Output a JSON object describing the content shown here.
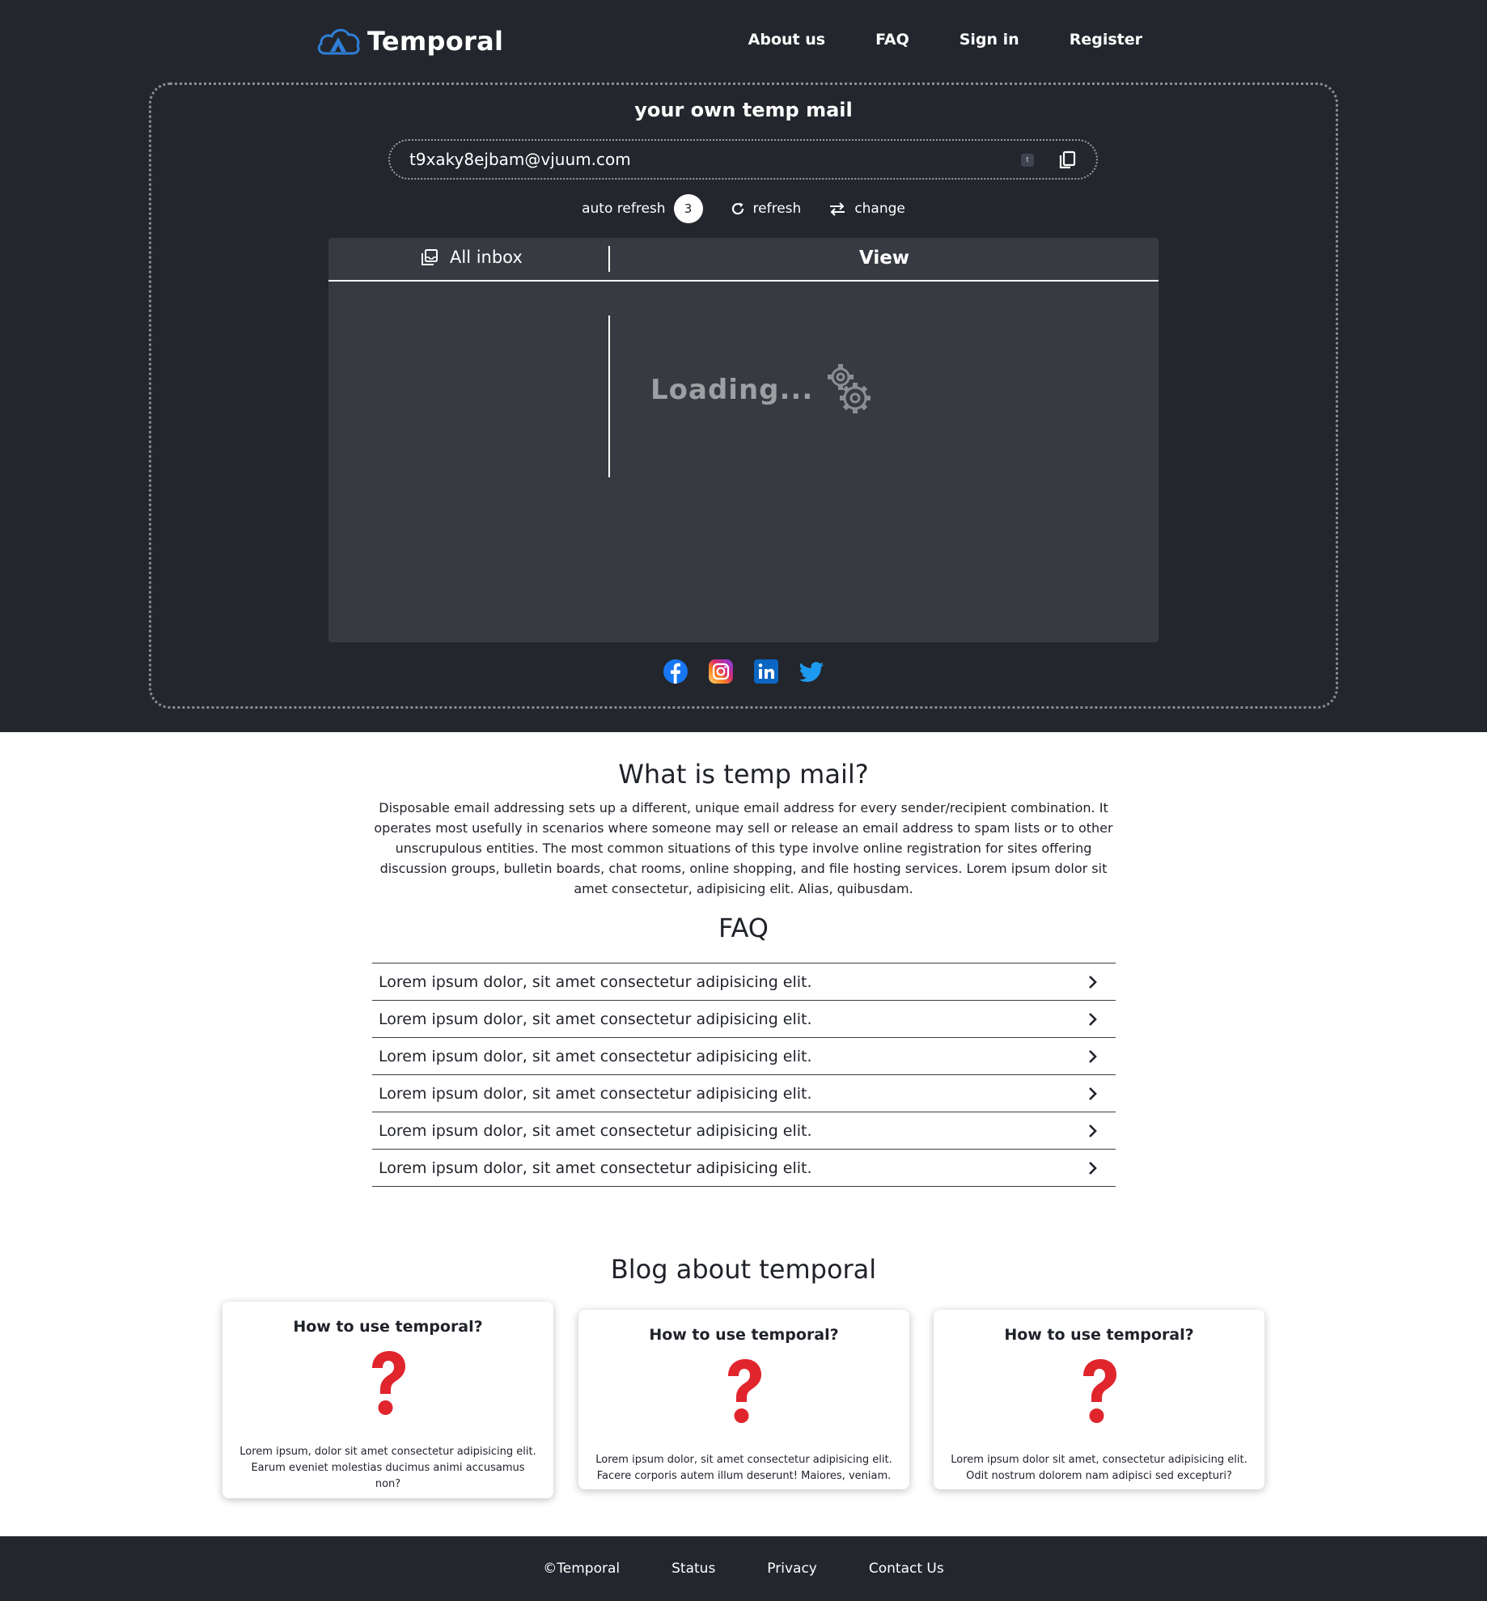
{
  "brand": {
    "name": "Temporal",
    "color": "#2f7fd8"
  },
  "nav": {
    "items": [
      "About us",
      "FAQ",
      "Sign in",
      "Register"
    ]
  },
  "mail": {
    "title": "your own temp mail",
    "address": "t9xaky8ejbam@vjuum.com",
    "badge": "t",
    "auto_refresh_label": "auto refresh",
    "auto_refresh_count": "3",
    "refresh_label": "refresh",
    "change_label": "change"
  },
  "inbox": {
    "tab_label": "All inbox",
    "view_label": "View",
    "loading_text": "Loading..."
  },
  "socials": [
    "facebook-icon",
    "instagram-icon",
    "linkedin-icon",
    "twitter-icon"
  ],
  "about": {
    "title": "What is temp mail?",
    "text": "Disposable email addressing sets up a different, unique email address for every sender/recipient combination. It operates most usefully in scenarios where someone may sell or release an email address to spam lists or to other unscrupulous entities. The most common situations of this type involve online registration for sites offering discussion groups, bulletin boards, chat rooms, online shopping, and file hosting services. Lorem ipsum dolor sit amet consectetur, adipisicing elit. Alias, quibusdam."
  },
  "faq": {
    "title": "FAQ",
    "items": [
      "Lorem ipsum dolor, sit amet consectetur adipisicing elit.",
      "Lorem ipsum dolor, sit amet consectetur adipisicing elit.",
      "Lorem ipsum dolor, sit amet consectetur adipisicing elit.",
      "Lorem ipsum dolor, sit amet consectetur adipisicing elit.",
      "Lorem ipsum dolor, sit amet consectetur adipisicing elit.",
      "Lorem ipsum dolor, sit amet consectetur adipisicing elit."
    ]
  },
  "blog": {
    "title": "Blog about temporal",
    "cards": [
      {
        "title": "How to use temporal?",
        "text": "Lorem ipsum, dolor sit amet consectetur adipisicing elit. Earum eveniet molestias ducimus animi accusamus non?"
      },
      {
        "title": "How to use temporal?",
        "text": "Lorem ipsum dolor, sit amet consectetur adipisicing elit. Facere corporis autem illum deserunt! Maiores, veniam."
      },
      {
        "title": "How to use temporal?",
        "text": "Lorem ipsum dolor sit amet, consectetur adipisicing elit. Odit nostrum dolorem nam adipisci sed excepturi?"
      }
    ]
  },
  "footer": {
    "items": [
      "©Temporal",
      "Status",
      "Privacy",
      "Contact Us"
    ]
  }
}
